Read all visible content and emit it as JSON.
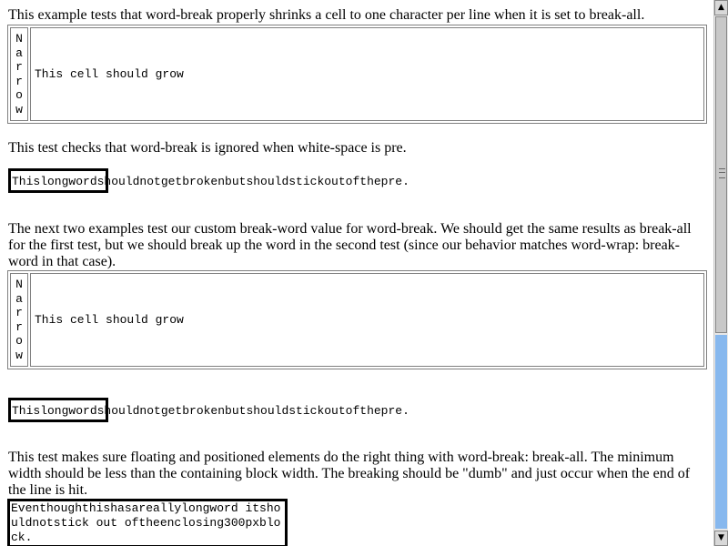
{
  "tests": {
    "t1_desc": "This example tests that word-break properly shrinks a cell to one character per line when it is set to break-all.",
    "narrow_letters": [
      "N",
      "a",
      "r",
      "r",
      "o",
      "w"
    ],
    "grow_text": "This cell should grow",
    "t2_desc": "This test checks that word-break is ignored when white-space is pre.",
    "pre_text": "Thislongwordshouldnotgetbrokenbutshouldstickoutofthepre.",
    "t3_desc": "The next two examples test our custom break-word value for word-break. We should get the same results as break-all for the first test, but we should break up the word in the second test (since our behavior matches word-wrap: break-word in that case).",
    "t4_desc": "This test makes sure floating and positioned elements do the right thing with word-break: break-all. The minimum width should be less than the containing block width. The breaking should be \"dumb\" and just occur when the end of the line is hit.",
    "float_text": "Eventhoughthishasareallylongword itshouldnotstick out oftheenclosing300pxblock."
  },
  "scrollbar": {
    "thumb_fraction": 0.58
  }
}
